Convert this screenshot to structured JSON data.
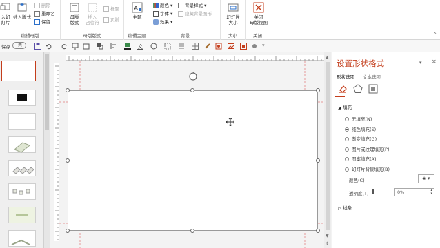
{
  "ribbon": {
    "insert_slide_master": "入幻\n灯片",
    "insert_layout": "插入版式",
    "delete": "删除",
    "rename": "重命名",
    "preserve": "保留",
    "group_edit_master": "编辑母版",
    "master_layout": "母版\n版式",
    "insert_placeholder": "插入\n占位符",
    "title_check": "标题",
    "footer_check": "页脚",
    "group_master_layout": "母版版式",
    "theme": "主题",
    "group_edit_theme": "编辑主题",
    "colors": "颜色",
    "fonts": "字体",
    "effects": "效果",
    "background_styles": "背景样式",
    "hide_background": "隐藏背景图形",
    "group_background": "背景",
    "slide_size": "幻灯片\n大小",
    "group_size": "大小",
    "close_master": "关闭\n母版视图",
    "group_close": "关闭"
  },
  "qat": {
    "autosave_label": "保存",
    "toggle_state": "关"
  },
  "pane": {
    "title": "设置形状格式",
    "tab_shape": "形状选项",
    "tab_text": "文本选项",
    "section_fill": "填充",
    "fill_options": [
      "无填充(N)",
      "纯色填充(S)",
      "渐变填充(G)",
      "图片或纹理填充(P)",
      "图案填充(A)",
      "幻灯片背景填充(B)"
    ],
    "selected_index": 1,
    "color_label": "颜色(C)",
    "transparency_label": "透明度(T)",
    "transparency_value": "0%",
    "section_line": "线条"
  },
  "colors": {
    "accent": "#c43e1c",
    "ribbon_bg": "#ffffff",
    "canvas_bg": "#f3f3f3"
  }
}
